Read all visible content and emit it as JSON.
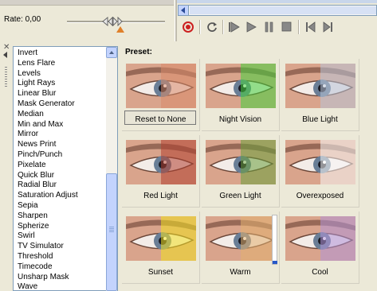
{
  "rate": {
    "label": "Rate: 0,00"
  },
  "effects_list": {
    "items": [
      "Invert",
      "Lens Flare",
      "Levels",
      "Light Rays",
      "Linear Blur",
      "Mask Generator",
      "Median",
      "Min and Max",
      "Mirror",
      "News Print",
      "Pinch/Punch",
      "Pixelate",
      "Quick Blur",
      "Radial Blur",
      "Saturation Adjust",
      "Sepia",
      "Sharpen",
      "Spherize",
      "Swirl",
      "TV Simulator",
      "Threshold",
      "Timecode",
      "Unsharp Mask",
      "Wave"
    ]
  },
  "preset": {
    "label": "Preset:",
    "items": [
      {
        "name": "Reset to None",
        "tint": "#d98a6a",
        "selected": true
      },
      {
        "name": "Night Vision",
        "tint": "#44d23c",
        "selected": false
      },
      {
        "name": "Blue Light",
        "tint": "#b8c4d8",
        "selected": false
      },
      {
        "name": "Red  Light",
        "tint": "#b04030",
        "selected": false
      },
      {
        "name": "Green  Light",
        "tint": "#6aa03c",
        "selected": false
      },
      {
        "name": "Overexposed",
        "tint": "#f8f8f8",
        "selected": false
      },
      {
        "name": "Sunset",
        "tint": "#f0e020",
        "selected": false
      },
      {
        "name": "Warm",
        "tint": "#e2b070",
        "selected": false
      },
      {
        "name": "Cool",
        "tint": "#b094d8",
        "selected": false
      }
    ]
  },
  "transport": {
    "icons": [
      "record-icon",
      "loop-icon",
      "play-from-start-icon",
      "play-icon",
      "pause-icon",
      "stop-icon",
      "go-to-start-icon",
      "go-to-end-icon"
    ]
  },
  "colors": {
    "accent": "#2858c8",
    "record_red": "#cc2020",
    "rate_marker": "#e0802a"
  }
}
